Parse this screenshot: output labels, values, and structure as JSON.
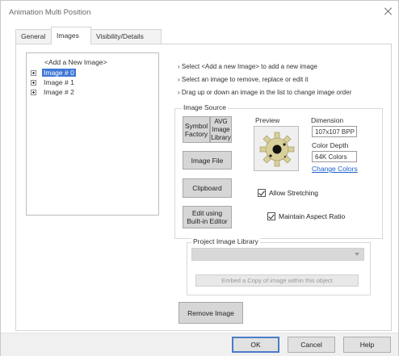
{
  "window": {
    "title": "Animation Multi Position"
  },
  "tabs": [
    {
      "label": "General"
    },
    {
      "label": "Images"
    },
    {
      "label": "Visibility/Details"
    }
  ],
  "tree": {
    "add_item": "<Add a New Image>",
    "items": [
      {
        "label": "Image # 0"
      },
      {
        "label": "Image # 1"
      },
      {
        "label": "Image # 2"
      }
    ]
  },
  "instructions": [
    "Select <Add a new Image> to add a new image",
    "Select an image to remove, replace or edit it",
    "Drag up or down an image in the list to change image order"
  ],
  "image_source": {
    "group_label": "Image Source",
    "symbol_factory_label": "Symbol Factory",
    "avg_library_label": "AVG Image Library",
    "image_file_label": "Image File",
    "clipboard_label": "Clipboard",
    "edit_label": "Edit using Built-in Editor",
    "preview_label": "Preview",
    "dimension_label": "Dimension",
    "dimension_value": "107x107 BPP",
    "color_depth_label": "Color Depth",
    "color_depth_value": "64K Colors",
    "change_colors_label": "Change Colors",
    "allow_stretching_label": "Allow Stretching",
    "allow_stretching_checked": true,
    "maintain_aspect_label": "Maintain Aspect Ratio",
    "maintain_aspect_checked": true
  },
  "project_library": {
    "group_label": "Project Image Library",
    "selected_value": "",
    "embed_label": "Embed a Copy of image within this object"
  },
  "remove_image_label": "Remove Image",
  "footer": {
    "ok_label": "OK",
    "cancel_label": "Cancel",
    "help_label": "Help"
  },
  "icons": {
    "close": "close-icon",
    "expand": "plus-expander-icon",
    "preview": "gear-image-preview",
    "dropdown": "chevron-down-icon"
  },
  "colors": {
    "selection": "#3f78d6",
    "link": "#1a5fd0",
    "button_face": "#d6d6d6",
    "default_button_border": "#4a7cc8"
  }
}
